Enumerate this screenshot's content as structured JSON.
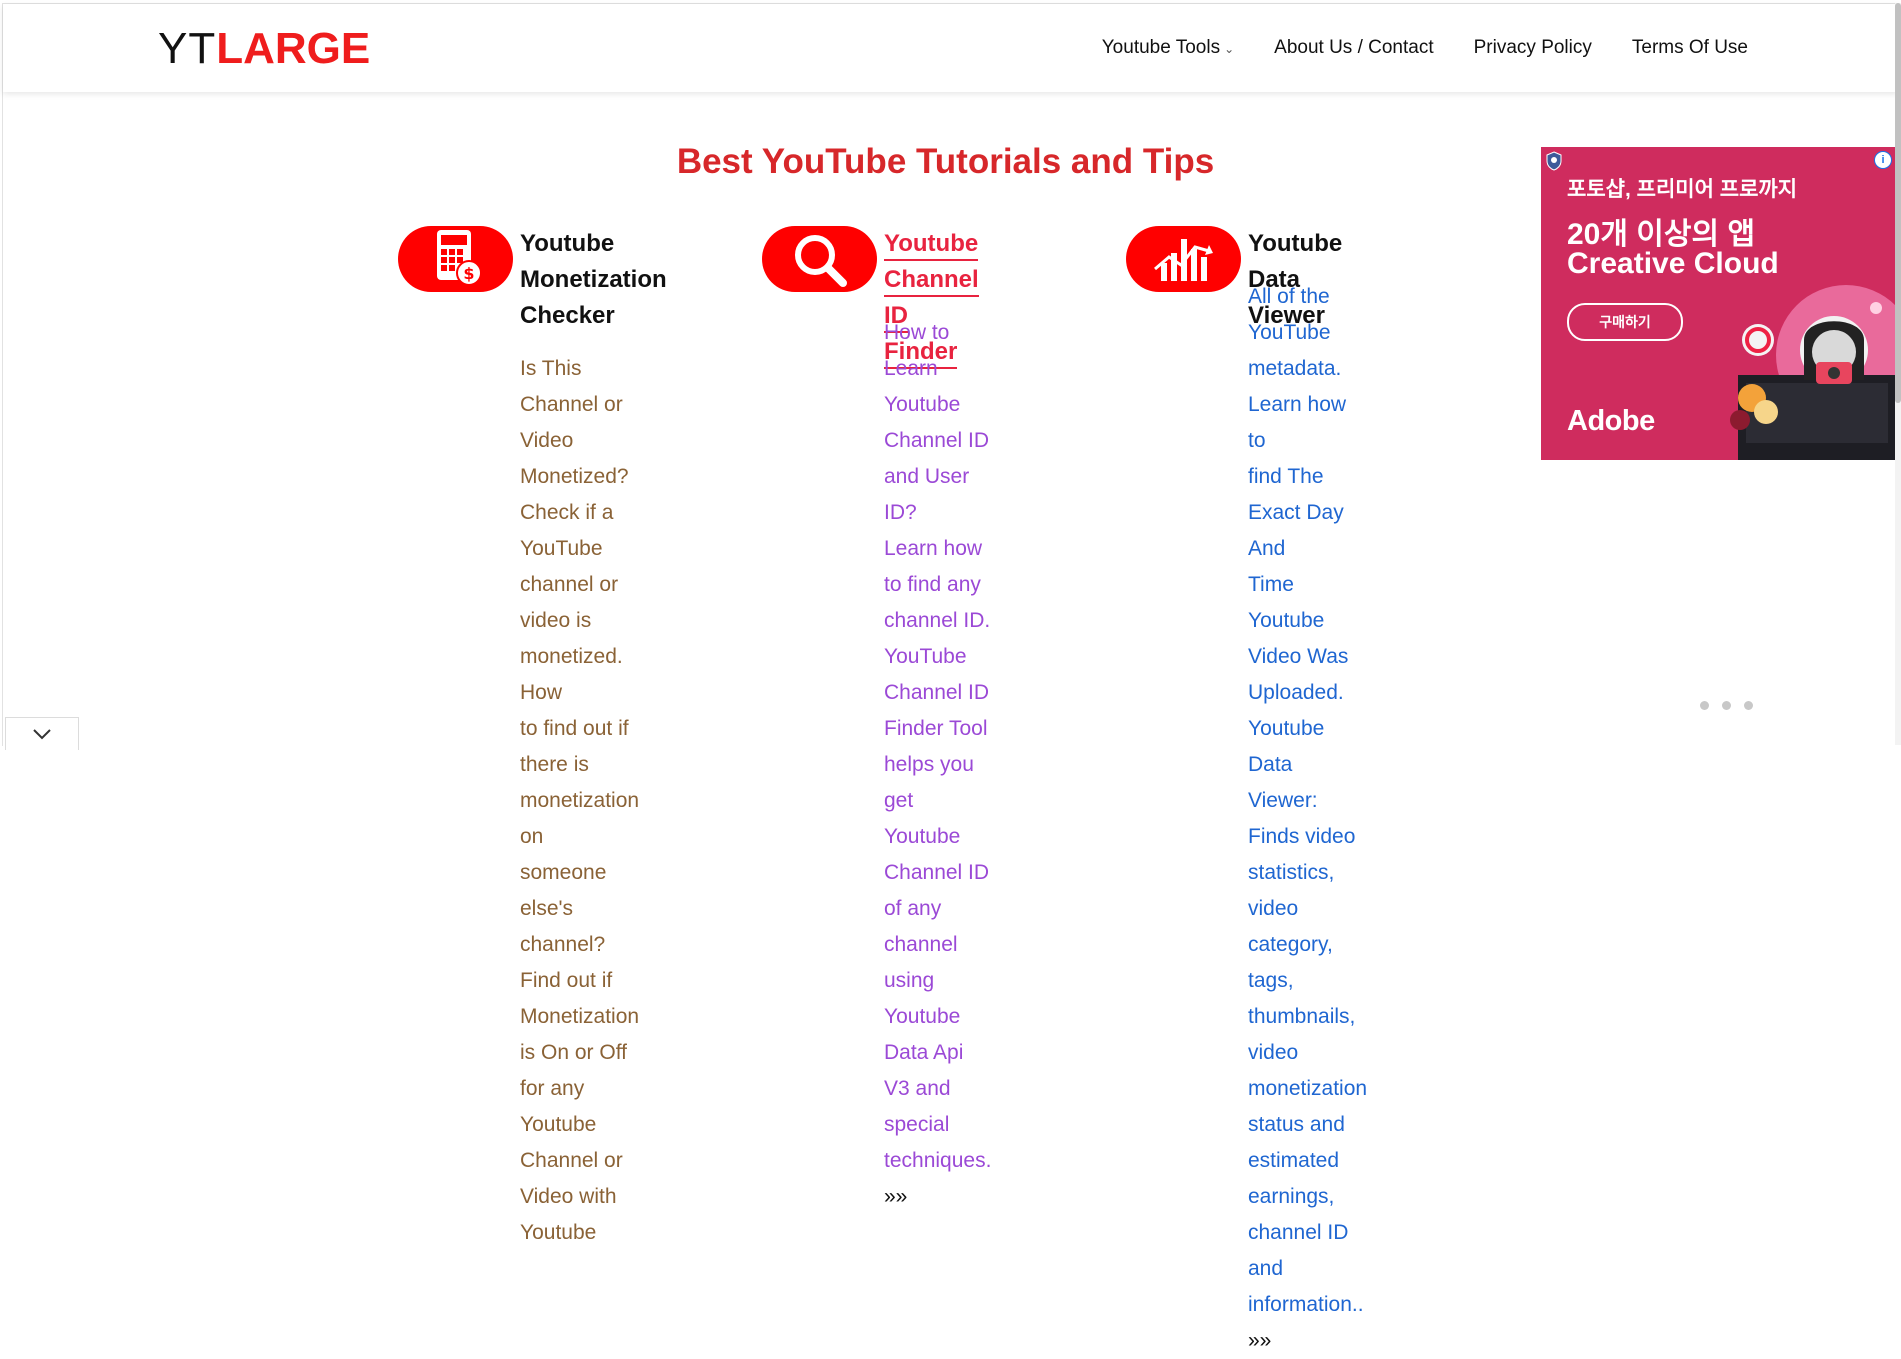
{
  "header": {
    "logo": {
      "part1": "YT",
      "part2": "LARGE"
    },
    "nav": [
      {
        "label": "Youtube Tools",
        "has_dropdown": true
      },
      {
        "label": "About Us / Contact"
      },
      {
        "label": "Privacy Policy"
      },
      {
        "label": "Terms Of Use"
      }
    ]
  },
  "main": {
    "title": "Best YouTube Tutorials and Tips",
    "cards": [
      {
        "icon": "calculator-dollar-icon",
        "title_lines": [
          "Youtube",
          "Monetization",
          "Checker"
        ],
        "desc_lines": [
          "Is This Channel or Video",
          "Monetized? Check if a",
          "YouTube channel or",
          "video is monetized. How",
          "to find out if there is",
          "monetization on",
          "someone else's channel?",
          "Find out if Monetization",
          "is On or Off for any",
          "Youtube Channel or",
          "Video with Youtube"
        ],
        "desc_color": "#8a6236"
      },
      {
        "icon": "magnifier-icon",
        "title_lines": [
          "Youtube Channel ID",
          "Finder"
        ],
        "desc_lines": [
          "How to Learn Youtube",
          "Channel ID and User ID?",
          "Learn how to find any",
          "channel ID. YouTube",
          "Channel ID Finder Tool",
          "helps you get Youtube",
          "Channel ID of any",
          "channel using Youtube",
          "Data Api V3 and special",
          "techniques."
        ],
        "more": "»»",
        "desc_color": "#9b49d6"
      },
      {
        "icon": "bar-chart-icon",
        "title_lines": [
          "Youtube Data Viewer"
        ],
        "desc_lines": [
          "All of the YouTube",
          "metadata. Learn how to",
          "find The Exact Day And",
          "Time Youtube Video Was",
          "Uploaded. Youtube Data",
          "Viewer: Finds video",
          "statistics, video category,",
          "tags, thumbnails, video",
          "monetization status and",
          "estimated earnings,",
          "channel ID and",
          "information.."
        ],
        "more": "»»",
        "desc_color": "#1f66d1"
      }
    ]
  },
  "ad": {
    "line1": "포토샵, 프리미어 프로까지",
    "line2": "20개 이상의 앱",
    "line3": "Creative Cloud",
    "button": "구매하기",
    "brand": "Adobe",
    "info": "i",
    "bg": "#cf2c5e"
  },
  "colors": {
    "brand_red": "#ff0000",
    "title_red": "#d7272a",
    "link_red": "#e8233f"
  }
}
